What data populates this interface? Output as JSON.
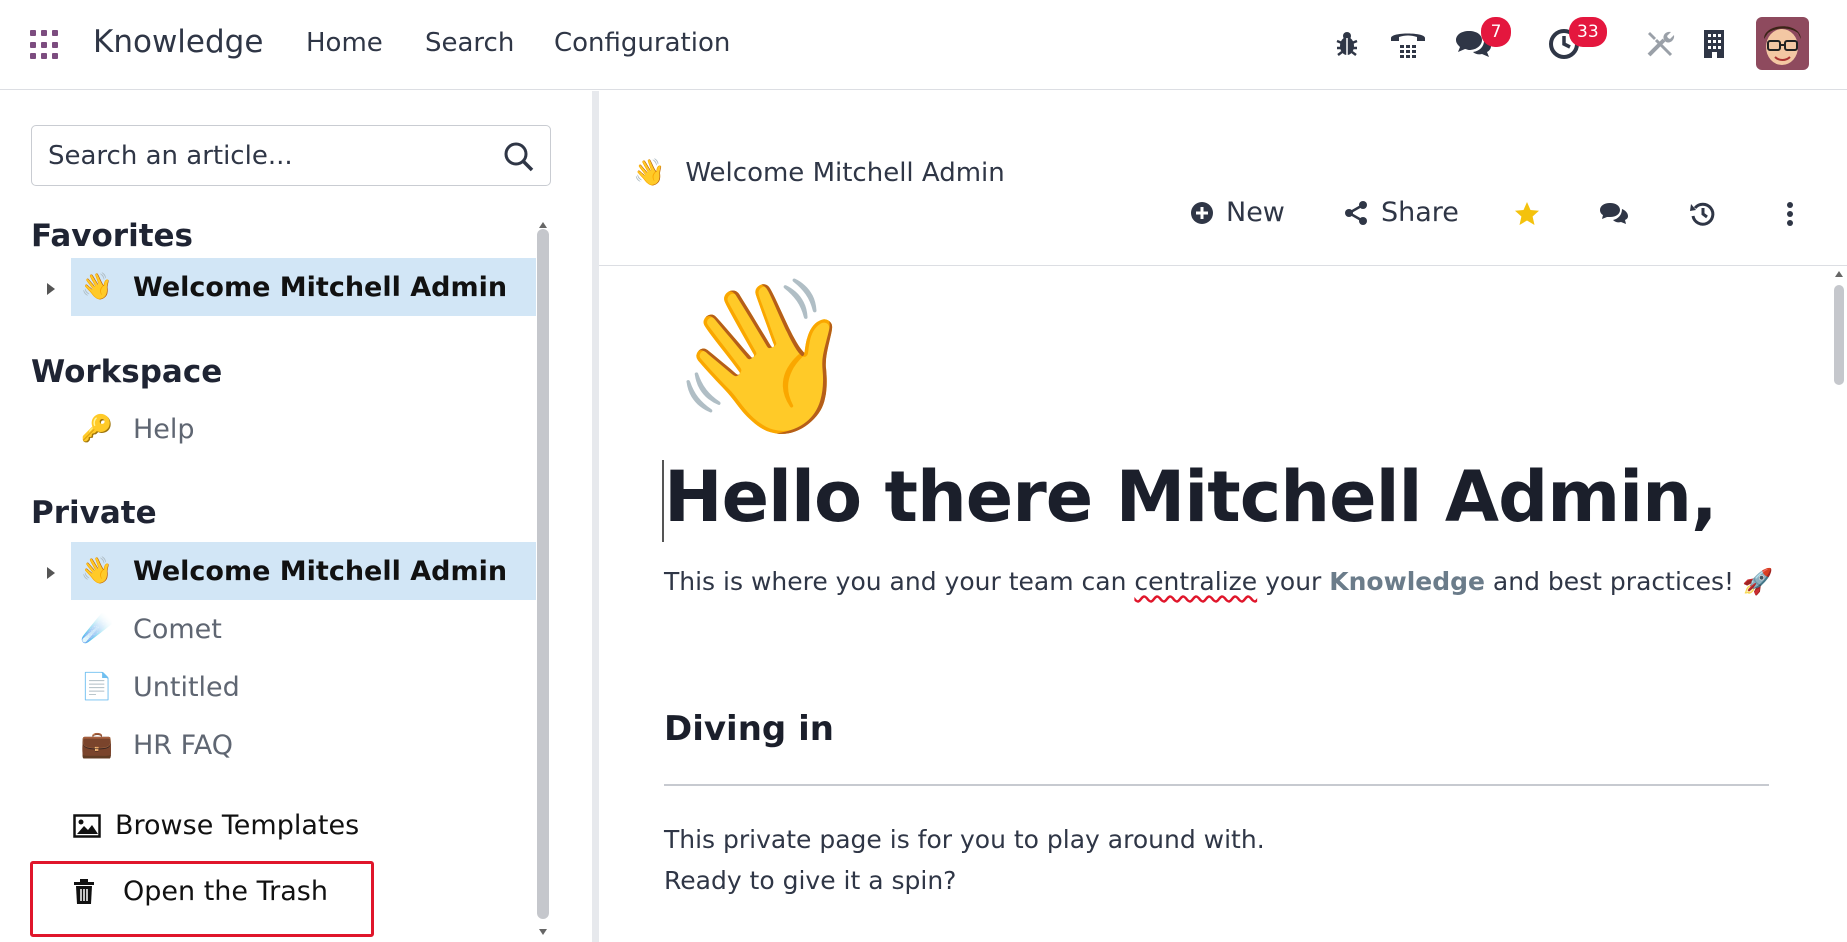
{
  "navbar": {
    "brand": "Knowledge",
    "menu": [
      "Home",
      "Search",
      "Configuration"
    ],
    "icons": [
      "bug-icon",
      "phone-icon",
      "chat-icon",
      "activity-clock-icon",
      "tools-icon",
      "building-icon"
    ],
    "badges": {
      "messages": "7",
      "activities": "33"
    },
    "badge_color": "#e4173e"
  },
  "sidebar": {
    "search_placeholder": "Search an article...",
    "favorites": {
      "title": "Favorites",
      "items": [
        {
          "emoji": "👋",
          "label": "Welcome Mitchell Admin",
          "selected": true
        }
      ]
    },
    "workspace": {
      "title": "Workspace",
      "items": [
        {
          "emoji": "🔑",
          "label": "Help"
        }
      ]
    },
    "private": {
      "title": "Private",
      "items": [
        {
          "emoji": "👋",
          "label": "Welcome Mitchell Admin",
          "selected": true
        },
        {
          "emoji": "☄️",
          "label": "Comet"
        },
        {
          "emoji": "📄",
          "label": "Untitled"
        },
        {
          "emoji": "💼",
          "label": "HR FAQ"
        }
      ]
    },
    "browse_templates": "Browse Templates",
    "open_trash": "Open the Trash",
    "highlight_color": "#e0162b"
  },
  "header": {
    "breadcrumb_emoji": "👋",
    "breadcrumb": "Welcome Mitchell Admin",
    "actions": {
      "new": "New",
      "share": "Share"
    },
    "favorite_color": "#f4c20d"
  },
  "article": {
    "cover_emoji": "👋",
    "title": "Hello there Mitchell Admin,",
    "lead_part1": "This is where you and your team can ",
    "lead_squiggle": "centralize",
    "lead_part2": " your ",
    "lead_keyword": "Knowledge",
    "lead_part3": " and best practices! 🚀",
    "section_title": "Diving in",
    "para1": "This private page is for you to play around with.",
    "para2": "Ready to give it a spin?"
  }
}
